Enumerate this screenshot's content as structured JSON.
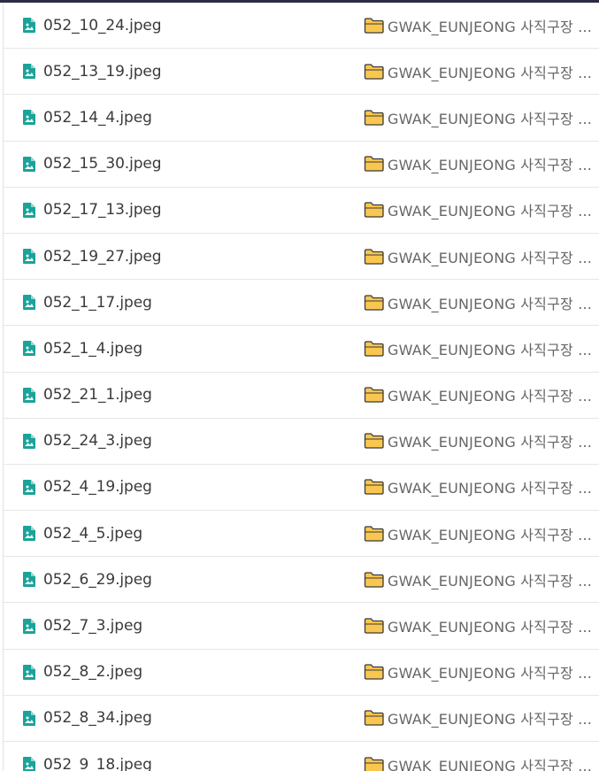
{
  "files": [
    {
      "name": "052_10_24.jpeg",
      "location": "GWAK_EUNJEONG 사직구장 ..."
    },
    {
      "name": "052_13_19.jpeg",
      "location": "GWAK_EUNJEONG 사직구장 ..."
    },
    {
      "name": "052_14_4.jpeg",
      "location": "GWAK_EUNJEONG 사직구장 ..."
    },
    {
      "name": "052_15_30.jpeg",
      "location": "GWAK_EUNJEONG 사직구장 ..."
    },
    {
      "name": "052_17_13.jpeg",
      "location": "GWAK_EUNJEONG 사직구장 ..."
    },
    {
      "name": "052_19_27.jpeg",
      "location": "GWAK_EUNJEONG 사직구장 ..."
    },
    {
      "name": "052_1_17.jpeg",
      "location": "GWAK_EUNJEONG 사직구장 ..."
    },
    {
      "name": "052_1_4.jpeg",
      "location": "GWAK_EUNJEONG 사직구장 ..."
    },
    {
      "name": "052_21_1.jpeg",
      "location": "GWAK_EUNJEONG 사직구장 ..."
    },
    {
      "name": "052_24_3.jpeg",
      "location": "GWAK_EUNJEONG 사직구장 ..."
    },
    {
      "name": "052_4_19.jpeg",
      "location": "GWAK_EUNJEONG 사직구장 ..."
    },
    {
      "name": "052_4_5.jpeg",
      "location": "GWAK_EUNJEONG 사직구장 ..."
    },
    {
      "name": "052_6_29.jpeg",
      "location": "GWAK_EUNJEONG 사직구장 ..."
    },
    {
      "name": "052_7_3.jpeg",
      "location": "GWAK_EUNJEONG 사직구장 ..."
    },
    {
      "name": "052_8_2.jpeg",
      "location": "GWAK_EUNJEONG 사직구장 ..."
    },
    {
      "name": "052_8_34.jpeg",
      "location": "GWAK_EUNJEONG 사직구장 ..."
    },
    {
      "name": "052_9_18.jpeg",
      "location": "GWAK_EUNJEONG 사직구장 ..."
    }
  ],
  "icons": {
    "file": "image-file-icon",
    "folder": "folder-icon"
  },
  "colors": {
    "file_icon": "#1aa39a",
    "folder_fill": "#f9c74f",
    "folder_stroke": "#3a3a3a",
    "top_bar": "#2a2d45"
  }
}
